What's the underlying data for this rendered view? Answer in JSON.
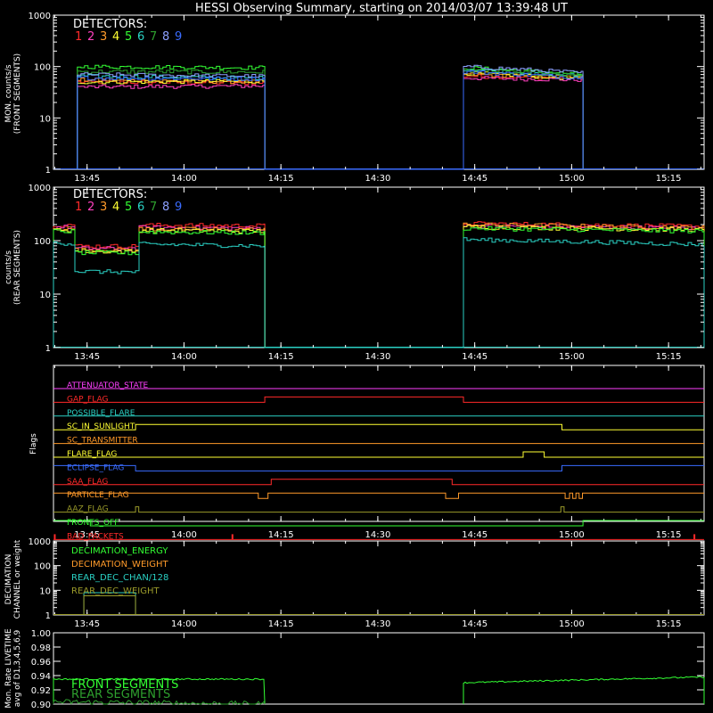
{
  "title": "HESSI Observing Summary, starting on 2014/03/07 13:39:48 UT",
  "colors": {
    "det": [
      "#ff2a2a",
      "#ff40c0",
      "#ff9a2a",
      "#ffff33",
      "#33ff33",
      "#2ad1c4",
      "#2ea02e",
      "#8ca0ff",
      "#3a6cff"
    ],
    "axis": "#ffffff"
  },
  "time_ticks": [
    "13:45",
    "14:00",
    "14:15",
    "14:30",
    "14:45",
    "15:00",
    "15:15"
  ],
  "detectors": {
    "label": "DETECTORS:",
    "numbers": [
      "1",
      "2",
      "3",
      "4",
      "5",
      "6",
      "7",
      "8",
      "9"
    ]
  },
  "chart_data": [
    {
      "id": "front",
      "type": "line",
      "ylabel": [
        "MON. counts/s",
        "(FRONT SEGMENTS)"
      ],
      "yscale": "log",
      "ylim": [
        1,
        1000
      ],
      "ytick_labels": [
        "1",
        "10",
        "100",
        "1000"
      ],
      "xlim": [
        "13:39:48",
        "15:20:30"
      ],
      "intervals": [
        [
          "13:43:30",
          "14:12:30"
        ],
        [
          "14:43:15",
          "15:01:45"
        ]
      ],
      "series": [
        {
          "color": "#ff2a2a",
          "segments": [
            [
              50,
              48
            ],
            [
              65,
              60
            ]
          ]
        },
        {
          "color": "#ff40c0",
          "segments": [
            [
              40,
              42
            ],
            [
              60,
              55
            ]
          ]
        },
        {
          "color": "#ff9a2a",
          "segments": [
            [
              55,
              50
            ],
            [
              70,
              62
            ]
          ]
        },
        {
          "color": "#ffff33",
          "segments": [
            [
              50,
              52
            ],
            [
              75,
              58
            ]
          ]
        },
        {
          "color": "#33ff33",
          "segments": [
            [
              100,
              95
            ],
            [
              95,
              70
            ]
          ]
        },
        {
          "color": "#2ad1c4",
          "segments": [
            [
              65,
              60
            ],
            [
              90,
              65
            ]
          ]
        },
        {
          "color": "#2ea02e",
          "segments": [
            [
              80,
              78
            ],
            [
              85,
              65
            ]
          ]
        },
        {
          "color": "#8ca0ff",
          "segments": [
            [
              70,
              65
            ],
            [
              100,
              75
            ]
          ]
        },
        {
          "color": "#3a6cff",
          "segments": [
            [
              60,
              58
            ],
            [
              80,
              60
            ]
          ]
        }
      ]
    },
    {
      "id": "rear",
      "type": "line",
      "ylabel": [
        "counts/s",
        "(REAR SEGMENTS)"
      ],
      "yscale": "log",
      "ylim": [
        1,
        1000
      ],
      "ytick_labels": [
        "1",
        "10",
        "100",
        "1000"
      ],
      "xlim": [
        "13:39:48",
        "15:20:30"
      ],
      "intervals": [
        [
          "13:39:48",
          "14:12:30"
        ],
        [
          "14:43:15",
          "15:20:30"
        ]
      ],
      "series": [
        {
          "color": "#ff2a2a",
          "segments": [
            [
              200,
              190
            ],
            [
              210,
              185
            ]
          ]
        },
        {
          "color": "#ff40c0",
          "segments": [
            [
              180,
              170
            ],
            [
              190,
              170
            ]
          ]
        },
        {
          "color": "#ff9a2a",
          "segments": [
            [
              170,
              160
            ],
            [
              200,
              175
            ]
          ]
        },
        {
          "color": "#ffff33",
          "segments": [
            [
              160,
              150
            ],
            [
              180,
              160
            ]
          ]
        },
        {
          "color": "#33ff33",
          "segments": [
            [
              150,
              140
            ],
            [
              170,
              150
            ]
          ]
        },
        {
          "color": "#2ad1c4",
          "segments": [
            [
              90,
              80
            ],
            [
              105,
              85
            ]
          ]
        }
      ],
      "dips": [
        {
          "from": "13:43:00",
          "to": "13:52:30",
          "factor": 0.4,
          "cyan_factor": 0.3
        }
      ]
    },
    {
      "id": "flags",
      "type": "line",
      "ylabel": [
        "Flags"
      ],
      "xlim": [
        "13:39:48",
        "15:20:30"
      ],
      "flags": [
        {
          "name": "ATTENUATOR_STATE",
          "color": "#ff40ff",
          "high": []
        },
        {
          "name": "GAP_FLAG",
          "color": "#ff2a2a",
          "high": [
            [
              "14:12:30",
              "14:43:15"
            ]
          ]
        },
        {
          "name": "POSSIBLE_FLARE",
          "color": "#2ad1c4",
          "high": []
        },
        {
          "name": "SC_IN_SUNLIGHT",
          "color": "#ffff33",
          "high": [
            [
              "13:52:30",
              "14:58:30"
            ]
          ]
        },
        {
          "name": "SC_TRANSMITTER",
          "color": "#ff9a2a",
          "high": []
        },
        {
          "name": "FLARE_FLAG",
          "color": "#ffff33",
          "high": [
            [
              "14:52:30",
              "14:55:45"
            ]
          ]
        },
        {
          "name": "ECLIPSE_FLAG",
          "color": "#3a6cff",
          "high": [
            [
              "13:39:48",
              "13:52:30"
            ],
            [
              "14:58:30",
              "15:20:30"
            ]
          ]
        },
        {
          "name": "SAA_FLAG",
          "color": "#ff2a2a",
          "high": [
            [
              "14:13:30",
              "14:41:30"
            ]
          ]
        },
        {
          "name": "PARTICLE_FLAG",
          "color": "#ff9a2a",
          "high": [
            [
              "13:39:48",
              "14:11:30"
            ],
            [
              "14:13:00",
              "14:40:30"
            ],
            [
              "14:42:30",
              "14:59:00"
            ],
            [
              "14:59:40",
              "15:00:10"
            ],
            [
              "15:00:40",
              "15:01:10"
            ],
            [
              "15:01:40",
              "15:20:30"
            ]
          ]
        },
        {
          "name": "AAZ_FLAG",
          "color": "#9a9a2a",
          "high": [
            [
              "13:52:30",
              "13:53:00"
            ],
            [
              "14:58:20",
              "14:58:50"
            ]
          ]
        },
        {
          "name": "FRONTS_OFF",
          "color": "#33ff33",
          "high": [
            [
              "13:39:48",
              "13:45:30"
            ],
            [
              "15:01:45",
              "15:20:30"
            ]
          ]
        },
        {
          "name": "BAD_PACKETS",
          "color": "#ff2a2a",
          "spikes": [
            "13:40:00",
            "14:07:30",
            "15:19:00"
          ]
        }
      ]
    },
    {
      "id": "decimation",
      "type": "line",
      "ylabel": [
        "DECIMATION",
        "CHANNEL or weight"
      ],
      "yscale": "log",
      "ylim": [
        1,
        1000
      ],
      "ytick_labels": [
        "1",
        "10",
        "100",
        "1000"
      ],
      "xlim": [
        "13:39:48",
        "15:20:30"
      ],
      "series": [
        {
          "name": "DECIMATION_ENERGY",
          "color": "#33ff33"
        },
        {
          "name": "DECIMATION_WEIGHT",
          "color": "#ff9a2a"
        },
        {
          "name": "REAR_DEC_CHAN/128",
          "color": "#2ad1c4"
        },
        {
          "name": "REAR_DEC_WEIGHT",
          "color": "#9a9a2a"
        }
      ],
      "rear_dec_chan_box": {
        "from": "13:44:30",
        "to": "13:52:30",
        "high": 8,
        "low": 6
      }
    },
    {
      "id": "livetime",
      "type": "line",
      "ylabel": [
        "Mon. Rate LIVETIME",
        "avg of D1,3,4,5,6,9"
      ],
      "ylim": [
        0.9,
        1.0
      ],
      "ytick_labels": [
        "0.90",
        "0.92",
        "0.94",
        "0.96",
        "0.98",
        "1.00"
      ],
      "xlim": [
        "13:39:48",
        "15:20:30"
      ],
      "series": [
        {
          "name": "FRONT SEGMENTS",
          "color": "#33ff33",
          "segments": [
            [
              "13:39:48",
              "14:12:30",
              0.935,
              0.935
            ],
            [
              "14:43:15",
              "15:20:30",
              0.93,
              0.938
            ]
          ]
        },
        {
          "name": "REAR SEGMENTS",
          "color": "#2ea02e",
          "segments": [
            [
              "13:39:48",
              "14:12:30",
              0.903,
              0.9
            ]
          ]
        }
      ]
    }
  ]
}
